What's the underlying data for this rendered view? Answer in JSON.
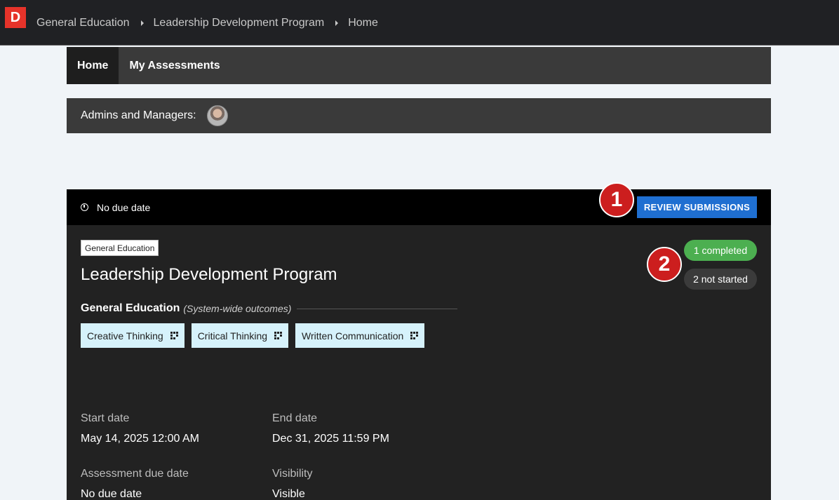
{
  "header": {
    "logo_letter": "D",
    "breadcrumbs": [
      "General Education",
      "Leadership Development Program",
      "Home"
    ]
  },
  "tabs": [
    {
      "label": "Home",
      "active": true
    },
    {
      "label": "My Assessments",
      "active": false
    }
  ],
  "admins": {
    "label": "Admins and Managers:"
  },
  "card": {
    "due_text": "No due date",
    "review_button": "REVIEW SUBMISSIONS",
    "tag": "General Education",
    "title": "Leadership Development Program",
    "outcomes_group": "General Education",
    "outcomes_sub": "(System-wide outcomes)",
    "outcomes": [
      "Creative Thinking",
      "Critical Thinking",
      "Written Communication"
    ],
    "status": {
      "completed": "1 completed",
      "not_started": "2 not started"
    },
    "fields": {
      "start_label": "Start date",
      "start_value": "May 14, 2025 12:00 AM",
      "end_label": "End date",
      "end_value": "Dec 31, 2025 11:59 PM",
      "due_label": "Assessment due date",
      "due_value": "No due date",
      "visibility_label": "Visibility",
      "visibility_value": "Visible"
    }
  },
  "markers": [
    "1",
    "2"
  ],
  "colors": {
    "accent_blue": "#1f6fd1",
    "completed_green": "#4caf50",
    "marker_red": "#cc1e1e",
    "logo_red": "#e6332a",
    "chip_bg": "#d6f2fb"
  }
}
